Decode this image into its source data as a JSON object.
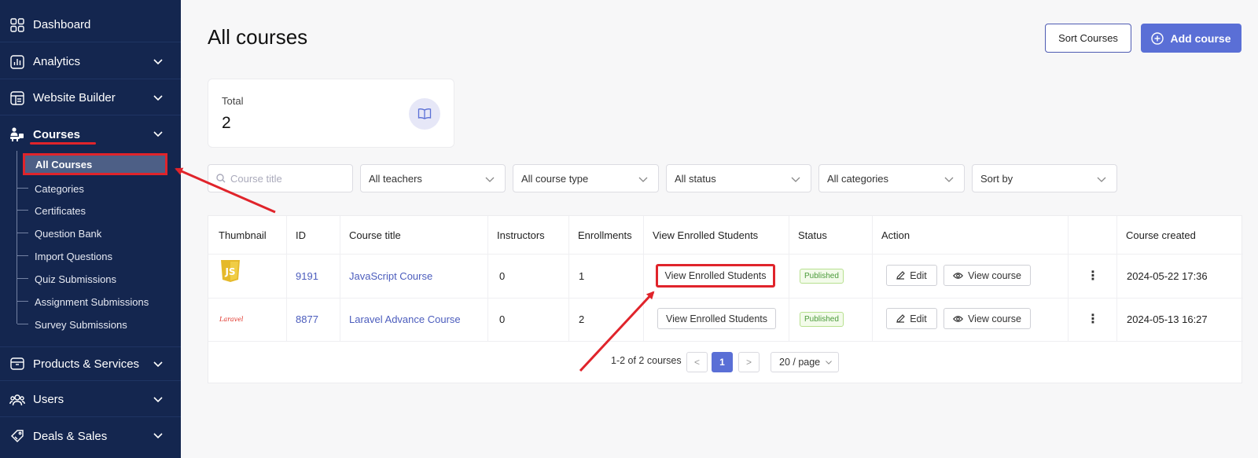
{
  "sidebar": {
    "items": [
      {
        "label": "Dashboard",
        "icon": "dashboard-icon"
      },
      {
        "label": "Analytics",
        "icon": "analytics-icon"
      },
      {
        "label": "Website Builder",
        "icon": "website-builder-icon"
      },
      {
        "label": "Courses",
        "icon": "courses-icon"
      },
      {
        "label": "Products & Services",
        "icon": "products-icon"
      },
      {
        "label": "Users",
        "icon": "users-icon"
      },
      {
        "label": "Deals & Sales",
        "icon": "deals-icon"
      }
    ],
    "courses_sub": [
      "All Courses",
      "Categories",
      "Certificates",
      "Question Bank",
      "Import Questions",
      "Quiz Submissions",
      "Assignment Submissions",
      "Survey Submissions"
    ]
  },
  "header": {
    "title": "All courses",
    "sort_label": "Sort Courses",
    "add_label": "Add course"
  },
  "stats": {
    "label": "Total",
    "value": "2"
  },
  "filters": {
    "search_placeholder": "Course title",
    "teachers": "All teachers",
    "course_type": "All course type",
    "status": "All status",
    "categories": "All categories",
    "sort_by": "Sort by"
  },
  "table": {
    "columns": [
      "Thumbnail",
      "ID",
      "Course title",
      "Instructors",
      "Enrollments",
      "View Enrolled Students",
      "Status",
      "Action",
      "",
      "Course created"
    ],
    "rows": [
      {
        "thumb": "JS",
        "id": "9191",
        "title": "JavaScript Course",
        "instructors": "0",
        "enrollments": "1",
        "view_btn": "View Enrolled Students",
        "status": "Published",
        "edit": "Edit",
        "view_course": "View course",
        "created": "2024-05-22 17:36"
      },
      {
        "thumb": "Laravel",
        "id": "8877",
        "title": "Laravel Advance Course",
        "instructors": "0",
        "enrollments": "2",
        "view_btn": "View Enrolled Students",
        "status": "Published",
        "edit": "Edit",
        "view_course": "View course",
        "created": "2024-05-13 16:27"
      }
    ]
  },
  "pagination": {
    "summary": "1-2 of 2 courses",
    "prev": "<",
    "current": "1",
    "next": ">",
    "page_size": "20 / page"
  },
  "colors": {
    "sidebar_bg": "#14264f",
    "accent": "#5a6fd6",
    "annotation": "#e0242b"
  }
}
